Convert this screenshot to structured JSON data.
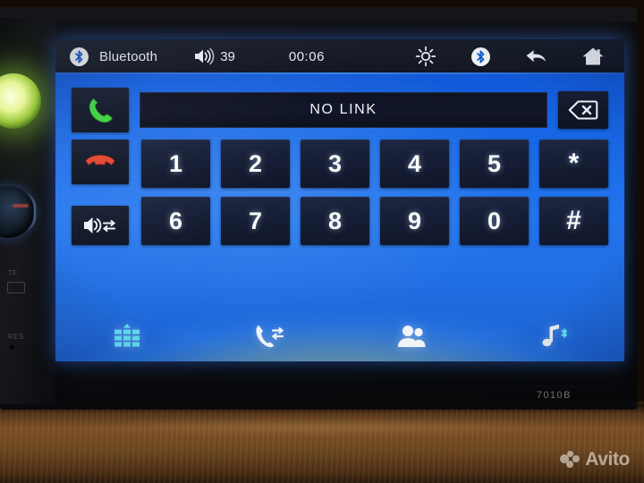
{
  "device": {
    "model_label": "7010B",
    "bezel_labels": {
      "tf": "TF",
      "reset": "RES"
    }
  },
  "screen": {
    "statusbar": {
      "bluetooth_icon": "bluetooth-icon",
      "source_label": "Bluetooth",
      "volume_icon": "volume-icon",
      "volume_value": "39",
      "time": "00:06",
      "brightness_icon": "brightness-icon",
      "bluetooth_toggle_icon": "bluetooth-icon",
      "back_icon": "back-arrow-icon",
      "home_icon": "home-icon"
    },
    "dialer": {
      "answer_icon": "phone-answer-icon",
      "number_display": "NO LINK",
      "backspace_icon": "backspace-icon",
      "hangup_icon": "phone-hangup-icon",
      "audio_transfer_icon": "audio-transfer-icon",
      "keys": [
        "1",
        "2",
        "3",
        "4",
        "5",
        "*",
        "6",
        "7",
        "8",
        "9",
        "0",
        "#"
      ]
    },
    "navbar": [
      {
        "name": "keypad",
        "icon": "dialpad-icon",
        "active": true
      },
      {
        "name": "call-log",
        "icon": "call-log-icon",
        "active": false
      },
      {
        "name": "contacts",
        "icon": "contacts-icon",
        "active": false
      },
      {
        "name": "bluetooth-music",
        "icon": "music-bluetooth-icon",
        "active": false
      }
    ]
  },
  "watermark": {
    "text": "Avito"
  },
  "colors": {
    "screen_blue": "#1f74f2",
    "status_bar": "#121722",
    "key_face": "#131b33",
    "answer_green": "#3fd442",
    "hangup_red": "#e8452f",
    "accent_cyan": "#4fe3f7"
  }
}
